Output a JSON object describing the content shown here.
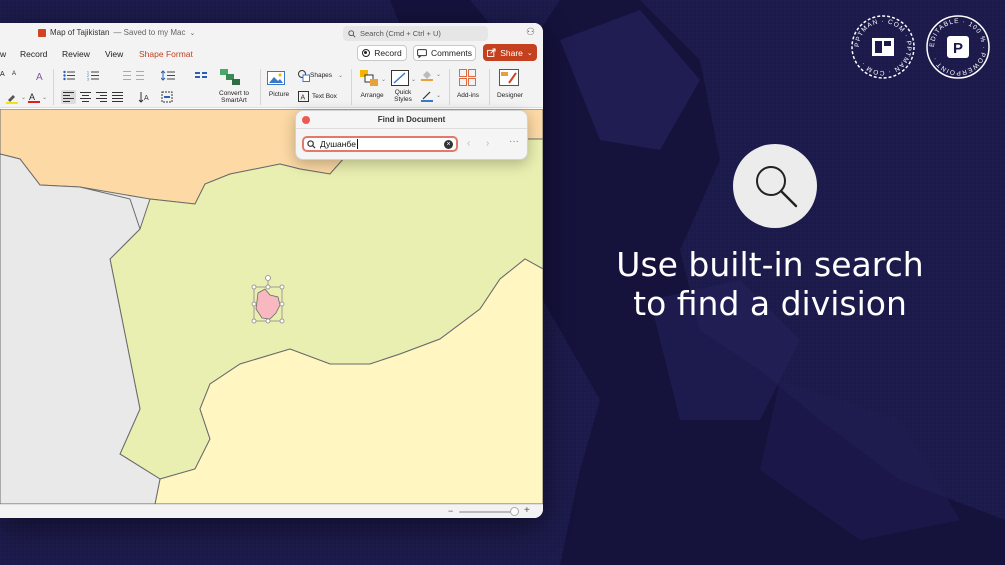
{
  "window": {
    "title_doc": "Map of Tajikistan",
    "title_saved": "— Saved to my Mac",
    "search_placeholder": "Search (Cmd + Ctrl + U)"
  },
  "menu": {
    "items": [
      {
        "label": "w",
        "id": "view-partial"
      },
      {
        "label": "Record",
        "id": "record"
      },
      {
        "label": "Review",
        "id": "review"
      },
      {
        "label": "View",
        "id": "view"
      },
      {
        "label": "Shape Format",
        "id": "shape-format",
        "active": true
      }
    ],
    "record_btn": "Record",
    "comments_btn": "Comments",
    "share_btn": "Share"
  },
  "ribbon": {
    "convert_smartart": "Convert to\nSmartArt",
    "picture": "Picture",
    "shapes": "Shapes",
    "text_box": "Text Box",
    "arrange": "Arrange",
    "quick_styles": "Quick\nStyles",
    "add_ins": "Add-ins",
    "designer": "Designer"
  },
  "find": {
    "title": "Find in Document",
    "query": "Душанбе"
  },
  "headline": {
    "line1": "Use built-in search",
    "line2": "to find a division"
  },
  "badges": {
    "left_ring": "PPTMAN · COM · PPTMAN · COM ·",
    "right_ring": "EDITABLE · 100 % · POWERPOINT ·"
  },
  "colors": {
    "background": "#1c1a4a",
    "accent": "#c4401e",
    "map_green": "#e9efb0",
    "map_orange": "#fcd9a5",
    "map_yellow": "#fff6c2",
    "map_gray": "#e9e9e9",
    "highlight": "#f7b8c0"
  }
}
